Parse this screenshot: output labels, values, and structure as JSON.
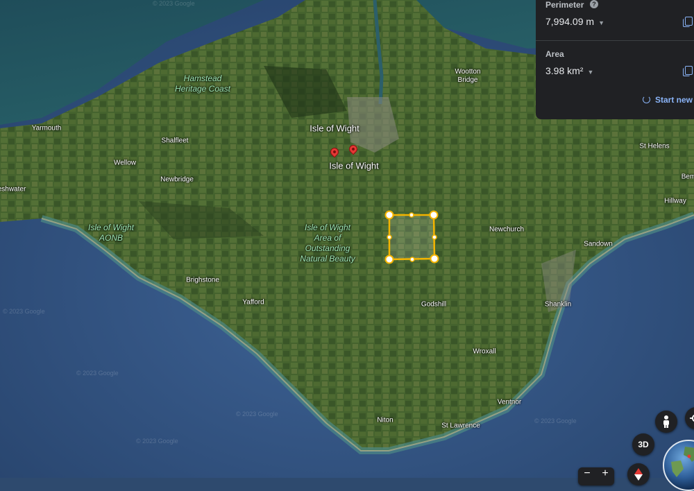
{
  "map": {
    "place_labels": [
      {
        "id": "yarmouth",
        "text": "Yarmouth",
        "size": "normal"
      },
      {
        "id": "shalfleet",
        "text": "Shalfleet",
        "size": "normal"
      },
      {
        "id": "wellow",
        "text": "Wellow",
        "size": "normal"
      },
      {
        "id": "newbridge",
        "text": "Newbridge",
        "size": "normal"
      },
      {
        "id": "freshwater",
        "text": "eshwater",
        "size": "normal"
      },
      {
        "id": "brighstone",
        "text": "Brighstone",
        "size": "normal"
      },
      {
        "id": "yafford",
        "text": "Yafford",
        "size": "normal"
      },
      {
        "id": "wootton-bridge",
        "text": "Wootton\nBridge",
        "size": "normal"
      },
      {
        "id": "st-helens",
        "text": "St Helens",
        "size": "normal"
      },
      {
        "id": "hillway",
        "text": "Hillway",
        "size": "normal"
      },
      {
        "id": "bembridge",
        "text": "Bem",
        "size": "normal"
      },
      {
        "id": "newchurch",
        "text": "Newchurch",
        "size": "normal"
      },
      {
        "id": "sandown",
        "text": "Sandown",
        "size": "normal"
      },
      {
        "id": "shanklin",
        "text": "Shanklin",
        "size": "normal"
      },
      {
        "id": "godshill",
        "text": "Godshill",
        "size": "normal"
      },
      {
        "id": "wroxall",
        "text": "Wroxall",
        "size": "normal"
      },
      {
        "id": "ventnor",
        "text": "Ventnor",
        "size": "normal"
      },
      {
        "id": "niton",
        "text": "Niton",
        "size": "normal"
      },
      {
        "id": "st-lawrence",
        "text": "St Lawrence",
        "size": "normal"
      },
      {
        "id": "isle-of-wight-1",
        "text": "Isle of Wight",
        "size": "big"
      },
      {
        "id": "isle-of-wight-2",
        "text": "Isle of Wight",
        "size": "big"
      }
    ],
    "park_labels": [
      {
        "id": "hamstead",
        "text": "Hamstead\nHeritage Coast"
      },
      {
        "id": "iow-aonb",
        "text": "Isle of Wight\nAONB"
      },
      {
        "id": "iow-aonb-long",
        "text": "Isle of Wight\nArea of\nOutstanding\nNatural Beauty"
      }
    ],
    "watermark": "© 2023 Google"
  },
  "measure_panel": {
    "perimeter_label": "Perimeter",
    "perimeter_value": "7,994.09 m",
    "help_glyph": "?",
    "area_label": "Area",
    "area_value": "3.98 km²",
    "start_new_label": "Start new"
  },
  "controls": {
    "three_d_label": "3D",
    "zoom_out_label": "−",
    "zoom_in_label": "+"
  },
  "colors": {
    "panel_bg": "#202124",
    "accent_blue": "#8ab4f8",
    "polygon_outline": "#f4b400",
    "pin_red": "#e53935"
  }
}
